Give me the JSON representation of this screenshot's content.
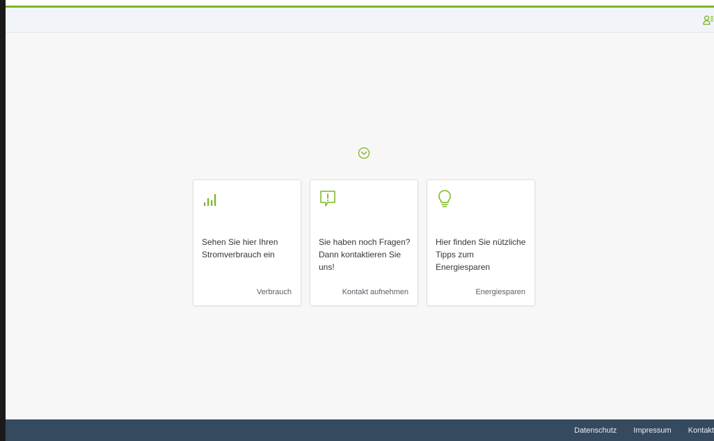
{
  "colors": {
    "accent": "#7ab51d",
    "footer_bg": "#354a5f",
    "header_bg": "#f1f5fa"
  },
  "header": {
    "user_icon": "user-settings-icon"
  },
  "main": {
    "scroll_icon": "chevron-down-circle-icon",
    "cards": [
      {
        "icon": "bar-chart-icon",
        "text": "Sehen Sie hier Ihren Stromverbrauch ein",
        "link": "Verbrauch"
      },
      {
        "icon": "speech-alert-icon",
        "text": "Sie haben noch Fragen? Dann kontaktieren Sie uns!",
        "link": "Kontakt aufnehmen"
      },
      {
        "icon": "lightbulb-icon",
        "text": "Hier finden Sie nützliche Tipps zum Energiesparen",
        "link": "Energiesparen"
      }
    ]
  },
  "footer": {
    "links": [
      "Datenschutz",
      "Impressum",
      "Kontakt"
    ]
  }
}
